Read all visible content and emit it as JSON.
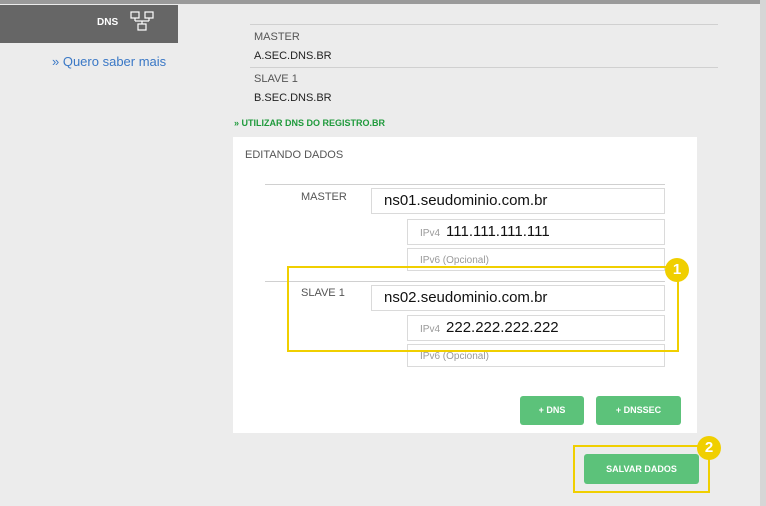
{
  "sidebar": {
    "tab_label": "DNS",
    "more_link": "» Quero saber mais"
  },
  "current_dns": [
    {
      "label": "MASTER",
      "value": "A.SEC.DNS.BR"
    },
    {
      "label": "SLAVE 1",
      "value": "B.SEC.DNS.BR"
    }
  ],
  "use_registro_link": "» UTILIZAR DNS DO REGISTRO.BR",
  "edit_panel": {
    "title": "EDITANDO DADOS",
    "entries": [
      {
        "label": "MASTER",
        "hostname": "ns01.seudominio.com.br",
        "ipv4_prefix": "IPv4",
        "ipv4": "111.111.111.111",
        "ipv6_placeholder": "IPv6 (Opcional)"
      },
      {
        "label": "SLAVE 1",
        "hostname": "ns02.seudominio.com.br",
        "ipv4_prefix": "IPv4",
        "ipv4": "222.222.222.222",
        "ipv6_placeholder": "IPv6 (Opcional)"
      }
    ],
    "add_dns_label": "+ DNS",
    "add_dnssec_label": "+ DNSSEC"
  },
  "save_label": "SALVAR DADOS",
  "callouts": [
    "1",
    "2"
  ],
  "colors": {
    "accent_green": "#5cc27a",
    "link_blue": "#3a78c6",
    "link_green": "#1f9a3c",
    "highlight_yellow": "#f0cf00",
    "tab_gray": "#666666"
  }
}
